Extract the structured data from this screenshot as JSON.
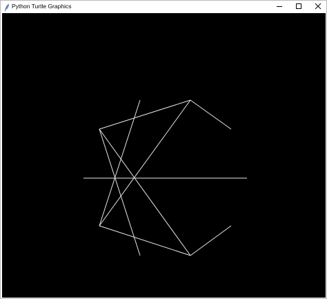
{
  "window": {
    "title": "Python Turtle Graphics",
    "icon": "feather-icon"
  },
  "controls": {
    "minimize_icon": "minimize-icon",
    "maximize_icon": "maximize-icon",
    "close_icon": "close-icon"
  },
  "canvas": {
    "background_color": "#000000",
    "pen_color": "#ffffff"
  }
}
